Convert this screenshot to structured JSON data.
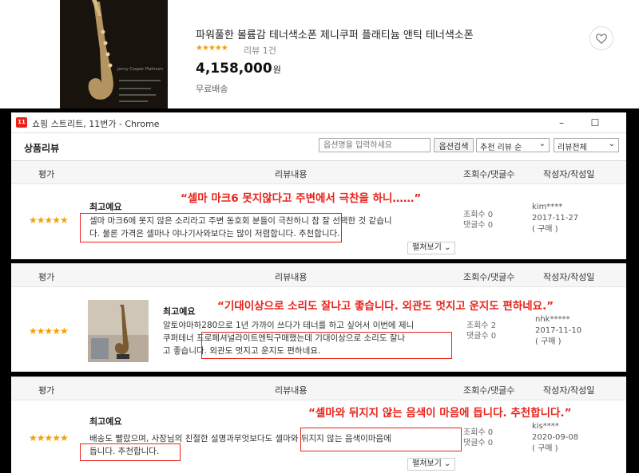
{
  "product": {
    "title": "파워풀한 볼륨감 테너색소폰 제니쿠퍼 플래티늄 앤틱 테너색소폰",
    "stars": "★★★★★",
    "review_count": "리뷰 1건",
    "price": "4,158,000",
    "price_unit": "원",
    "shipping": "무료배송",
    "image_text": "Jenny Cooper Platinum"
  },
  "window": {
    "app_icon": "11번",
    "title": "쇼핑 스트리트, 11번가 - Chrome",
    "minimize": "–",
    "maximize": "☐"
  },
  "reviews_header": {
    "section_title": "상품리뷰",
    "option_placeholder": "옵션명을 입력하세요",
    "option_search": "옵션검색",
    "sort_select": "추천 리뷰 순",
    "filter_select": "리뷰전체"
  },
  "columns": {
    "rating": "평가",
    "content": "리뷰내용",
    "views": "조회수/댓글수",
    "author": "작성자/작성일"
  },
  "reviews": [
    {
      "stars": "★★★★★",
      "label": "최고예요",
      "line1": "셀마 마크6에 못지 않은 소리라고 주변 동호회 분들이 극찬하니 참 잘 선택한 것 같습니",
      "line2": "다. 물론 가격은 셀마나 야나기사와보다는 많이 저렴합니다. 추천합니다.",
      "line3": "",
      "views": "조회수 0",
      "comments": "댓글수 0",
      "author": "kim****",
      "date": "2017-11-27",
      "purchase": "( 구매 )",
      "more": "펼쳐보기 ⌄",
      "callout": "“셀마 마크6 못지않다고 주변에서 극찬을 하니……”"
    },
    {
      "stars": "★★★★★",
      "label": "최고예요",
      "line1": "알토야마하280으로 1년 가까이 쓰다가 테너를 하고 싶어서 이번에 제니",
      "line2": "쿠퍼테너 프로페셔널라이트엔틱구매했는데 기대이상으로 소리도 잘나",
      "line3": "고 좋습니다. 외관도 멋지고 운지도 편하네요.",
      "views": "조회수 2",
      "comments": "댓글수 0",
      "author": "nhk*****",
      "date": "2017-11-10",
      "purchase": "( 구매 )",
      "more": "",
      "callout": "“기대이상으로 소리도 잘나고 좋습니다. 외관도 멋지고 운지도 편하네요.”"
    },
    {
      "stars": "★★★★★",
      "label": "최고예요",
      "line1": "배송도 빨랐으며, 사장님의 친절한 설명과무엇보다도 셀마와 뒤지지 않는 음색이마음에",
      "line2": "듭니다. 추천합니다.",
      "line3": "",
      "views": "조회수 0",
      "comments": "댓글수 0",
      "author": "kis****",
      "date": "2020-09-08",
      "purchase": "( 구매 )",
      "more": "펼쳐보기 ⌄",
      "callout": "“셀마와 뒤지지 않는 음색이 마음에 듭니다. 추천합니다.”"
    }
  ],
  "colors": {
    "accent_red": "#e8231b",
    "star": "#f5a100"
  }
}
